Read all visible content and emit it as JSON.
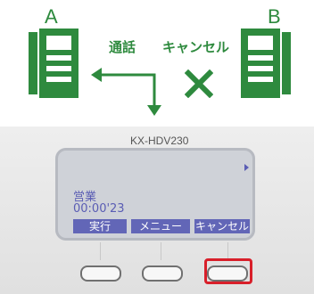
{
  "diagram": {
    "phone_a_label": "A",
    "phone_b_label": "B",
    "call_label": "通話",
    "cancel_label": "キャンセル",
    "colors": {
      "green": "#2e8a3e",
      "highlight": "#d81f2a",
      "lcd_text": "#5a5db4"
    }
  },
  "phone": {
    "model": "KX-HDV230",
    "screen": {
      "line1": "営業",
      "line2": "00:00'23",
      "softkeys": [
        "実行",
        "メニュー",
        "キャンセル"
      ]
    },
    "highlighted_button_index": 2
  }
}
